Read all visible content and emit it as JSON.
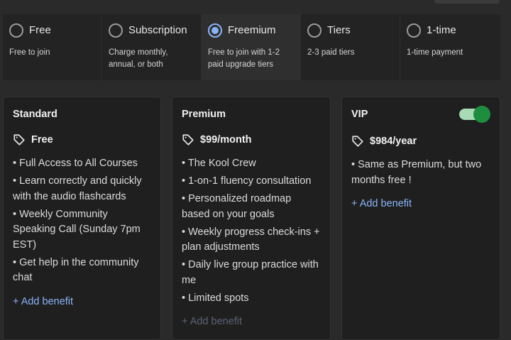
{
  "pricing_models": [
    {
      "label": "Free",
      "description": "Free to join",
      "selected": false
    },
    {
      "label": "Subscription",
      "description": "Charge monthly, annual, or both",
      "selected": false
    },
    {
      "label": "Freemium",
      "description": "Free to join with 1-2 paid upgrade tiers",
      "selected": true
    },
    {
      "label": "Tiers",
      "description": "2-3 paid tiers",
      "selected": false
    },
    {
      "label": "1-time",
      "description": "1-time payment",
      "selected": false
    }
  ],
  "tiers": [
    {
      "name": "Standard",
      "price": "Free",
      "benefits": [
        "• Full Access to All Courses",
        "• Learn correctly and quickly with the audio flashcards",
        "• Weekly Community Speaking Call (Sunday 7pm EST)",
        "• Get help in the community chat"
      ],
      "add_benefit_label": "+ Add benefit"
    },
    {
      "name": "Premium",
      "price": "$99/month",
      "benefits": [
        "• The Kool Crew",
        "• 1-on-1 fluency consultation",
        "• Personalized roadmap based on your goals",
        "• Weekly progress check-ins + plan adjustments",
        "• Daily live group practice with me",
        "• Limited spots"
      ],
      "add_benefit_label": "+ Add benefit"
    },
    {
      "name": "VIP",
      "price": "$984/year",
      "toggle_on": true,
      "benefits": [
        "• Same as Premium, but two months free !"
      ],
      "add_benefit_label": "+ Add benefit"
    }
  ],
  "colors": {
    "accent": "#8ab4f8",
    "toggle_track": "#a8dab5",
    "toggle_thumb": "#1e8e3e",
    "disabled_link": "#5a6475"
  },
  "icons": {
    "price": "tag-icon",
    "radio": "radio-icon"
  }
}
